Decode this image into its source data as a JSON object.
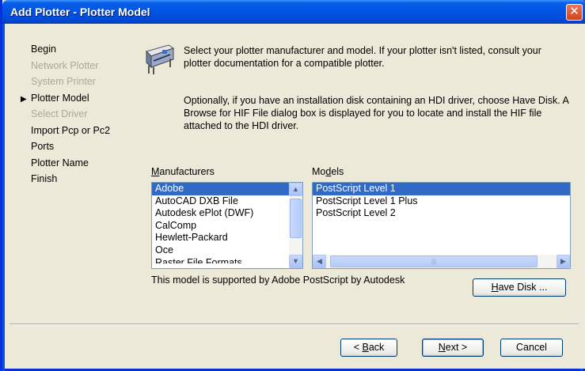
{
  "window": {
    "title": "Add Plotter - Plotter Model",
    "close_label": "✕"
  },
  "steps": [
    {
      "label": "Begin",
      "state": "done"
    },
    {
      "label": "Network Plotter",
      "state": "disabled"
    },
    {
      "label": "System Printer",
      "state": "disabled"
    },
    {
      "label": "Plotter Model",
      "state": "current"
    },
    {
      "label": "Select Driver",
      "state": "disabled"
    },
    {
      "label": "Import Pcp or Pc2",
      "state": "normal"
    },
    {
      "label": "Ports",
      "state": "normal"
    },
    {
      "label": "Plotter Name",
      "state": "normal"
    },
    {
      "label": "Finish",
      "state": "normal"
    }
  ],
  "description": {
    "line1": "Select your plotter manufacturer and model. If your plotter isn't listed, consult your plotter documentation for a compatible plotter.",
    "line2": "Optionally, if you have an installation disk containing an HDI driver, choose Have Disk. A Browse for HIF File dialog box is displayed for you to locate and install the HIF file attached to the HDI driver."
  },
  "manufacturers": {
    "label_first": "M",
    "label_rest": "anufacturers",
    "selected": "Adobe",
    "items": [
      "Adobe",
      "AutoCAD DXB File",
      "Autodesk ePlot (DWF)",
      "CalComp",
      "Hewlett-Packard",
      "Oce",
      "Raster File Formats"
    ]
  },
  "models": {
    "label_first": "Mo",
    "label_underline": "d",
    "label_rest": "els",
    "selected": "PostScript Level 1",
    "items": [
      "PostScript Level 1",
      "PostScript Level 1 Plus",
      "PostScript Level 2"
    ]
  },
  "support_text": "This model is supported by Adobe PostScript by Autodesk",
  "buttons": {
    "have_disk_first": "H",
    "have_disk_rest": "ave Disk ...",
    "back_prefix": "< ",
    "back_first": "B",
    "back_rest": "ack",
    "next_first": "N",
    "next_rest": "ext >",
    "cancel": "Cancel"
  },
  "colors": {
    "title_bar": "#0054e3",
    "selection": "#316ac5",
    "dialog_bg": "#ece9d8",
    "disabled_text": "#aca899"
  }
}
